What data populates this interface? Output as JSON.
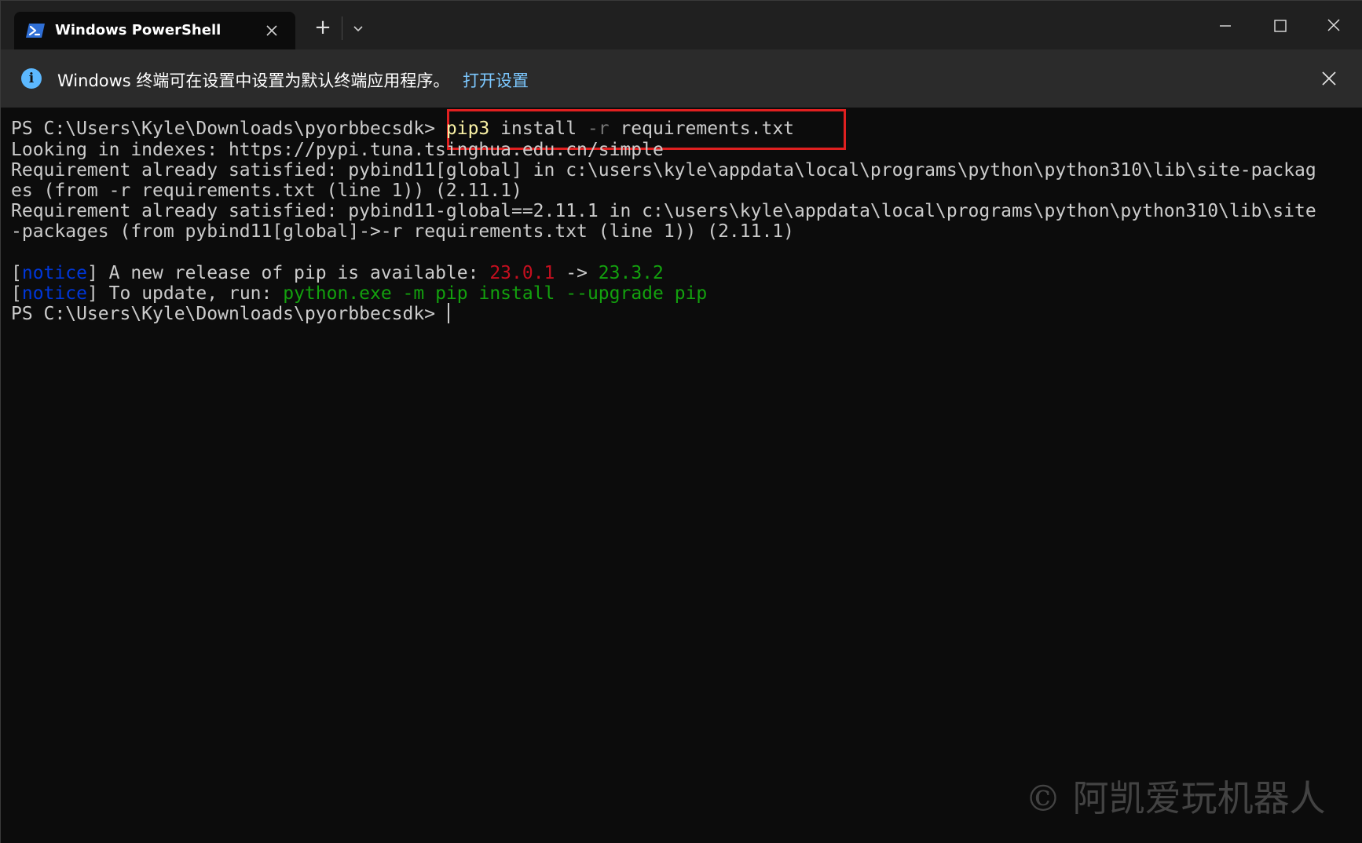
{
  "window": {
    "tab_title": "Windows PowerShell",
    "tab_icon": "powershell-icon",
    "close_tab_icon": "close-icon",
    "new_tab_label": "+",
    "dropdown_icon": "chevron-down-icon",
    "minimize_icon": "minimize-icon",
    "maximize_icon": "maximize-icon",
    "close_icon": "close-icon"
  },
  "infobar": {
    "icon": "info-icon",
    "icon_glyph": "i",
    "message": "Windows 终端可在设置中设置为默认终端应用程序。",
    "link": "打开设置",
    "close_icon": "close-icon"
  },
  "terminal": {
    "prompt": "PS C:\\Users\\Kyle\\Downloads\\pyorbbecsdk> ",
    "command": {
      "cmd": "pip3",
      "arg1": " install ",
      "flag": "-r",
      "arg2": " requirements.txt"
    },
    "output": [
      "Looking in indexes: https://pypi.tuna.tsinghua.edu.cn/simple",
      "Requirement already satisfied: pybind11[global] in c:\\users\\kyle\\appdata\\local\\programs\\python\\python310\\lib\\site-packag",
      "es (from -r requirements.txt (line 1)) (2.11.1)",
      "Requirement already satisfied: pybind11-global==2.11.1 in c:\\users\\kyle\\appdata\\local\\programs\\python\\python310\\lib\\site",
      "-packages (from pybind11[global]->-r requirements.txt (line 1)) (2.11.1)"
    ],
    "notice1": {
      "open": "[",
      "tag": "notice",
      "close": "]",
      "text": " A new release of pip is available: ",
      "old_version": "23.0.1",
      "arrow": " -> ",
      "new_version": "23.3.2"
    },
    "notice2": {
      "open": "[",
      "tag": "notice",
      "close": "]",
      "text": " To update, run: ",
      "command": "python.exe -m pip install --upgrade pip"
    },
    "final_prompt": "PS C:\\Users\\Kyle\\Downloads\\pyorbbecsdk> "
  },
  "watermark": "© 阿凯爱玩机器人",
  "colors": {
    "command_yellow": "#f9f1a5",
    "flag_gray": "#767676",
    "notice_blue": "#0037da",
    "old_version_red": "#c50f1f",
    "new_version_green": "#13a10e",
    "highlight_border": "#e02020",
    "link_blue": "#7cc8ff"
  }
}
